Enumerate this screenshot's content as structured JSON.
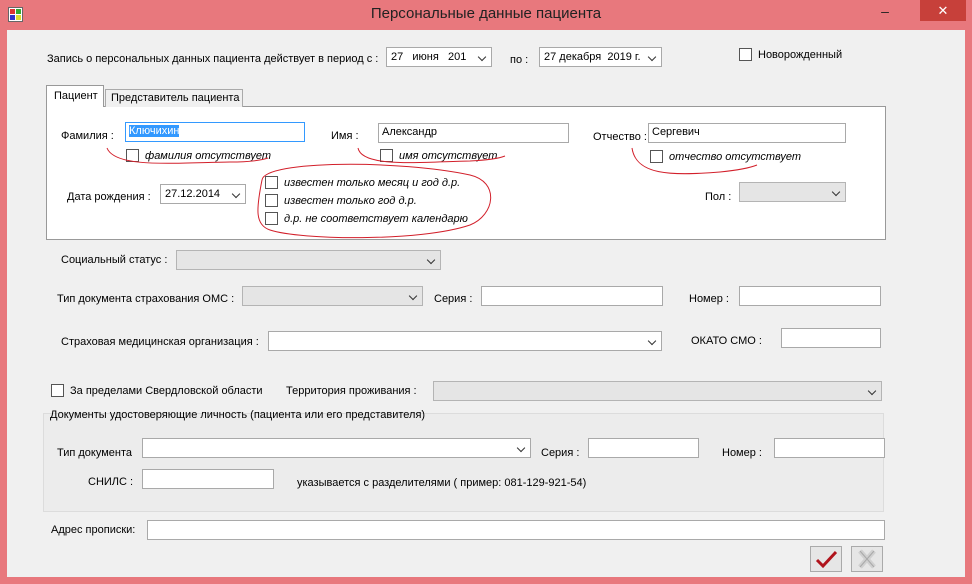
{
  "window": {
    "title": "Персональные данные пациента",
    "minimize_glyph": "–",
    "close_glyph": "✕"
  },
  "period": {
    "label": "Запись о персональных данных пациента  действует в период с :",
    "from_value": "27   июня   201",
    "to_label": "по :",
    "to_value": "27 декабря  2019 г."
  },
  "newborn": {
    "label": "Новорожденный"
  },
  "tabs": [
    {
      "label": "Пациент"
    },
    {
      "label": "Представитель пациента"
    }
  ],
  "patient": {
    "surname_label": "Фамилия :",
    "surname_value": "Ключихин",
    "no_surname_label": "фамилия отсутствует",
    "name_label": "Имя :",
    "name_value": "Александр",
    "no_name_label": "имя отсутствует",
    "patronymic_label": "Отчество :",
    "patronymic_value": "Сергевич",
    "no_patronymic_label": "отчество отсутствует",
    "birth_label": "Дата рождения :",
    "birth_value": "27.12.2014",
    "only_month_year_label": "известен только месяц и год д.р.",
    "only_year_label": "известен только  год д.р.",
    "not_calendar_label": "д.р. не соответствует календарю",
    "sex_label": "Пол :"
  },
  "social_status": {
    "label": "Социальный статус :"
  },
  "oms": {
    "doc_type_label": "Тип документа страхования ОМС :",
    "series_label": "Серия :",
    "number_label": "Номер :"
  },
  "smo": {
    "label": "Страховая медицинская организация :",
    "okato_label": "ОКАТО СМО :"
  },
  "outside_region": {
    "label": "За пределами Свердловской области"
  },
  "territory": {
    "label": "Территория проживания :"
  },
  "id_docs": {
    "group_label": "Документы удостоверяющие личность (пациента или его представителя)",
    "doc_type_label": "Тип документа",
    "series_label": "Серия :",
    "number_label": "Номер :",
    "snils_label": "СНИЛС :",
    "snils_hint": "указывается с разделителями ( пример: 081-129-921-54)"
  },
  "address": {
    "label": "Адрес прописки:"
  },
  "icons": {
    "ok": "checkmark-icon",
    "cancel": "cross-icon"
  },
  "annotation_color": "#d21f2a"
}
